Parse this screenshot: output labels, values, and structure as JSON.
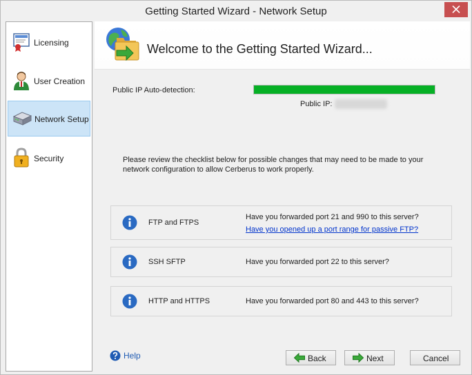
{
  "window": {
    "title": "Getting Started Wizard - Network Setup",
    "close_icon": "close-icon"
  },
  "sidebar": {
    "items": [
      {
        "label": "Licensing",
        "icon": "license-certificate-icon"
      },
      {
        "label": "User Creation",
        "icon": "user-icon"
      },
      {
        "label": "Network Setup",
        "icon": "network-router-icon",
        "active": true
      },
      {
        "label": "Security",
        "icon": "lock-icon"
      }
    ]
  },
  "header": {
    "title": "Welcome to the Getting Started Wizard...",
    "icon": "globe-folder-icon"
  },
  "ip_detection": {
    "label": "Public IP Auto-detection:",
    "progress_percent": 100,
    "progress_color": "#06b025",
    "public_ip_label": "Public IP:"
  },
  "intro": "Please review the checklist below for possible changes that may need to be made to your network configuration to allow Cerberus to work properly.",
  "checklist": [
    {
      "name": "FTP and FTPS",
      "question": "Have you forwarded port 21 and 990 to this server?",
      "link": "Have you opened up a port range for passive FTP?"
    },
    {
      "name": "SSH SFTP",
      "question": "Have you forwarded port 22 to this server?"
    },
    {
      "name": "HTTP and HTTPS",
      "question": "Have you forwarded port 80 and 443 to this server?"
    }
  ],
  "footer": {
    "help_label": "Help",
    "back_label": "Back",
    "next_label": "Next",
    "cancel_label": "Cancel"
  },
  "colors": {
    "accent_blue": "#1f5bb3",
    "active_nav_bg": "#cce4f7",
    "close_red": "#c74f50",
    "arrow_green": "#3aa83a"
  }
}
